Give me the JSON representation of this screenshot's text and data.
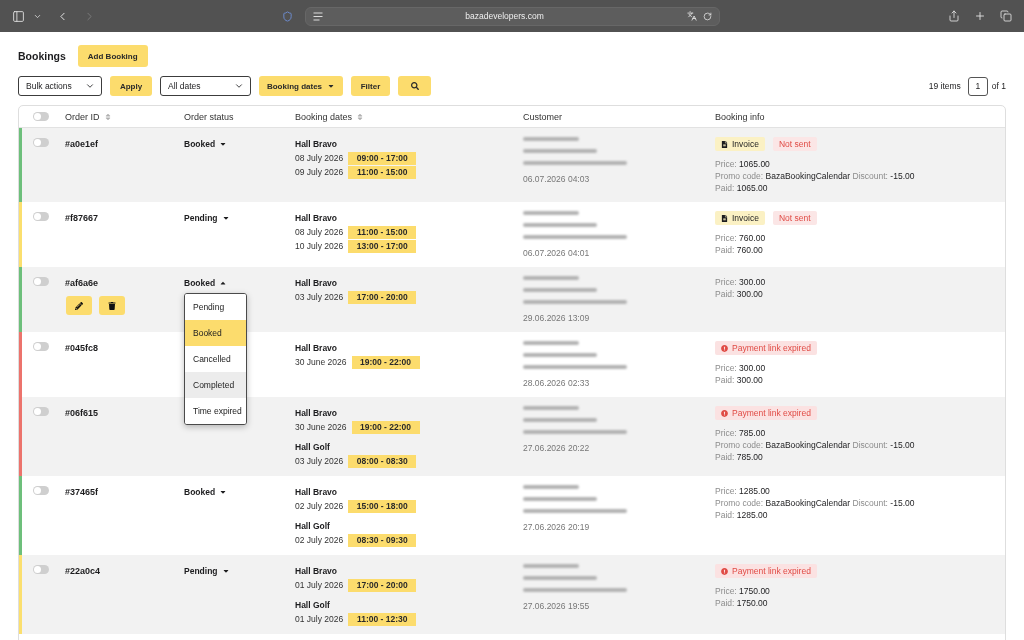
{
  "browser": {
    "url": "bazadevelopers.com",
    "back_enabled": true,
    "forward_enabled": false
  },
  "header": {
    "title": "Bookings",
    "add_button": "Add Booking"
  },
  "toolbar": {
    "bulk_actions": "Bulk actions",
    "apply_button": "Apply",
    "dates_select": "All dates",
    "booking_dates_button": "Booking dates",
    "filter_button": "Filter"
  },
  "pagination": {
    "items": "19 items",
    "page": "1",
    "total": "of 1"
  },
  "table": {
    "select_all": {
      "checked": false
    },
    "columns": [
      {
        "label": "Order ID",
        "sortable": true
      },
      {
        "label": "Order status",
        "sortable": false
      },
      {
        "label": "Booking dates",
        "sortable": true
      },
      {
        "label": "Customer",
        "sortable": false
      },
      {
        "label": "Booking info",
        "sortable": false
      }
    ],
    "rows": [
      {
        "order_id": "#a0e1ef",
        "checked": false,
        "color": "#6dbf7b",
        "actions_visible": false,
        "status": {
          "label": "Booked",
          "expanded": false
        },
        "halls": [
          {
            "name": "Hall Bravo",
            "slots": [
              {
                "date": "08 July 2026",
                "time": "09:00 - 17:00"
              },
              {
                "date": "09 July 2026",
                "time": "11:00 - 15:00"
              }
            ]
          }
        ],
        "customer": {
          "created": "06.07.2026 04:03"
        },
        "badges": [
          {
            "kind": "invoice",
            "label": "Invoice"
          },
          {
            "kind": "not_sent",
            "label": "Not sent"
          }
        ],
        "details": [
          [
            {
              "label": "Price:",
              "value": "1065.00"
            }
          ],
          [
            {
              "label": "Promo code:",
              "value": "BazaBookingCalendar"
            },
            {
              "label": "Discount:",
              "value": "-15.00"
            }
          ],
          [
            {
              "label": "Paid:",
              "value": "1065.00"
            }
          ]
        ]
      },
      {
        "order_id": "#f87667",
        "checked": false,
        "color": "#fbdf6e",
        "actions_visible": false,
        "status": {
          "label": "Pending",
          "expanded": false
        },
        "halls": [
          {
            "name": "Hall Bravo",
            "slots": [
              {
                "date": "08 July 2026",
                "time": "11:00 - 15:00"
              },
              {
                "date": "10 July 2026",
                "time": "13:00 - 17:00"
              }
            ]
          }
        ],
        "customer": {
          "created": "06.07.2026 04:01"
        },
        "badges": [
          {
            "kind": "invoice",
            "label": "Invoice"
          },
          {
            "kind": "not_sent",
            "label": "Not sent"
          }
        ],
        "details": [
          [
            {
              "label": "Price:",
              "value": "760.00"
            }
          ],
          [
            {
              "label": "Paid:",
              "value": "760.00"
            }
          ]
        ]
      },
      {
        "order_id": "#af6a6e",
        "checked": false,
        "color": "#6dbf7b",
        "actions_visible": true,
        "status": {
          "label": "Booked",
          "expanded": true,
          "options": [
            {
              "label": "Pending",
              "selected": false,
              "highlighted": false
            },
            {
              "label": "Booked",
              "selected": true,
              "highlighted": false
            },
            {
              "label": "Cancelled",
              "selected": false,
              "highlighted": false
            },
            {
              "label": "Completed",
              "selected": false,
              "highlighted": true
            },
            {
              "label": "Time expired",
              "selected": false,
              "highlighted": false
            }
          ]
        },
        "halls": [
          {
            "name": "Hall Bravo",
            "slots": [
              {
                "date": "03 July 2026",
                "time": "17:00 - 20:00"
              }
            ]
          }
        ],
        "customer": {
          "created": "29.06.2026 13:09"
        },
        "details": [
          [
            {
              "label": "Price:",
              "value": "300.00"
            }
          ],
          [
            {
              "label": "Paid:",
              "value": "300.00"
            }
          ]
        ]
      },
      {
        "order_id": "#045fc8",
        "checked": false,
        "color": "#ec736c",
        "actions_visible": false,
        "halls": [
          {
            "name": "Hall Bravo",
            "slots": [
              {
                "date": "30 June 2026",
                "time": "19:00 - 22:00"
              }
            ]
          }
        ],
        "customer": {
          "created": "28.06.2026 02:33"
        },
        "badges": [
          {
            "kind": "link_expired",
            "label": "Payment link expired"
          }
        ],
        "details": [
          [
            {
              "label": "Price:",
              "value": "300.00"
            }
          ],
          [
            {
              "label": "Paid:",
              "value": "300.00"
            }
          ]
        ]
      },
      {
        "order_id": "#06f615",
        "checked": false,
        "color": "#ec736c",
        "actions_visible": false,
        "halls": [
          {
            "name": "Hall Bravo",
            "slots": [
              {
                "date": "30 June 2026",
                "time": "19:00 - 22:00"
              }
            ]
          },
          {
            "name": "Hall Golf",
            "slots": [
              {
                "date": "03 July 2026",
                "time": "08:00 - 08:30"
              }
            ]
          }
        ],
        "customer": {
          "created": "27.06.2026 20:22"
        },
        "badges": [
          {
            "kind": "link_expired",
            "label": "Payment link expired"
          }
        ],
        "details": [
          [
            {
              "label": "Price:",
              "value": "785.00"
            }
          ],
          [
            {
              "label": "Promo code:",
              "value": "BazaBookingCalendar"
            },
            {
              "label": "Discount:",
              "value": "-15.00"
            }
          ],
          [
            {
              "label": "Paid:",
              "value": "785.00"
            }
          ]
        ]
      },
      {
        "order_id": "#37465f",
        "checked": false,
        "color": "#6dbf7b",
        "actions_visible": false,
        "status": {
          "label": "Booked",
          "expanded": false
        },
        "halls": [
          {
            "name": "Hall Bravo",
            "slots": [
              {
                "date": "02 July 2026",
                "time": "15:00 - 18:00"
              }
            ]
          },
          {
            "name": "Hall Golf",
            "slots": [
              {
                "date": "02 July 2026",
                "time": "08:30 - 09:30"
              }
            ]
          }
        ],
        "customer": {
          "created": "27.06.2026 20:19"
        },
        "details": [
          [
            {
              "label": "Price:",
              "value": "1285.00"
            }
          ],
          [
            {
              "label": "Promo code:",
              "value": "BazaBookingCalendar"
            },
            {
              "label": "Discount:",
              "value": "-15.00"
            }
          ],
          [
            {
              "label": "Paid:",
              "value": "1285.00"
            }
          ]
        ]
      },
      {
        "order_id": "#22a0c4",
        "checked": false,
        "color": "#fbdf6e",
        "actions_visible": false,
        "status": {
          "label": "Pending",
          "expanded": false
        },
        "halls": [
          {
            "name": "Hall Bravo",
            "slots": [
              {
                "date": "01 July 2026",
                "time": "17:00 - 20:00"
              }
            ]
          },
          {
            "name": "Hall Golf",
            "slots": [
              {
                "date": "01 July 2026",
                "time": "11:00 - 12:30"
              }
            ]
          }
        ],
        "customer": {
          "created": "27.06.2026 19:55"
        },
        "badges": [
          {
            "kind": "link_expired",
            "label": "Payment link expired"
          }
        ],
        "details": [
          [
            {
              "label": "Price:",
              "value": "1750.00"
            }
          ],
          [
            {
              "label": "Paid:",
              "value": "1750.00"
            }
          ]
        ]
      }
    ]
  }
}
